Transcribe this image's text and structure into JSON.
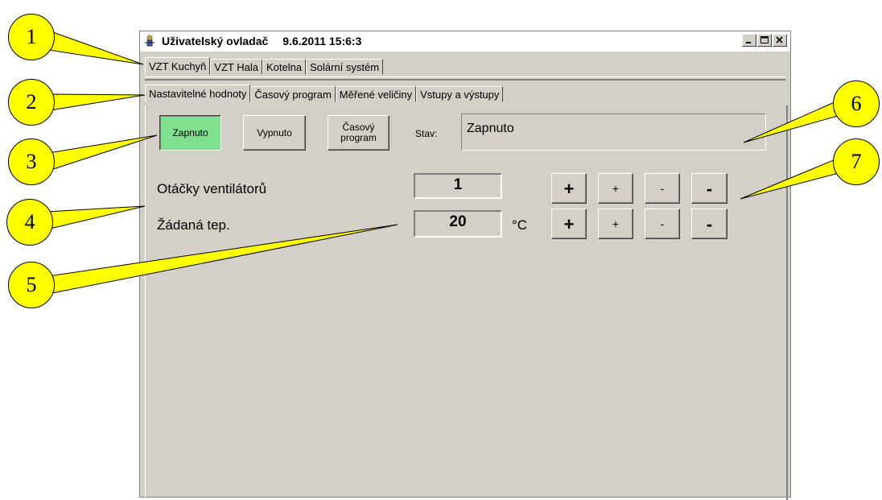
{
  "window": {
    "title": "Uživatelský ovladač",
    "datetime": "9.6.2011 15:6:3"
  },
  "outer_tabs": [
    "VZT Kuchyň",
    "VZT Hala",
    "Kotelna",
    "Solární systém"
  ],
  "inner_tabs": [
    "Nastavitelné hodnoty",
    "Časový program",
    "Měřené veličiny",
    "Vstupy a výstupy"
  ],
  "mode_buttons": {
    "on": "Zapnuto",
    "off": "Vypnuto",
    "schedule_line1": "Časový",
    "schedule_line2": "program"
  },
  "status": {
    "label": "Stav:",
    "value": "Zapnuto"
  },
  "fan": {
    "label": "Otáčky ventilátorů",
    "value": "1"
  },
  "temp": {
    "label": "Žádaná tep.",
    "value": "20",
    "unit": "°C"
  },
  "adjust": {
    "plus_big": "+",
    "plus_small": "+",
    "minus_small": "-",
    "minus_big": "-"
  },
  "callouts": [
    "1",
    "2",
    "3",
    "4",
    "5",
    "6",
    "7"
  ],
  "colors": {
    "callout": "#ffff00",
    "active_button": "#7fe08f",
    "window_bg": "#d4d0c8"
  }
}
